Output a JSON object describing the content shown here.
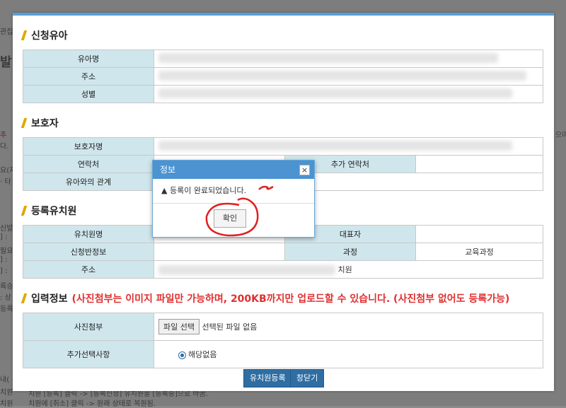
{
  "background_fragments": [
    "관집",
    "발",
    "추",
    "다.",
    "요(자",
    "· 타",
    "신발",
    "] :",
    "필요",
    "] :",
    "] :",
    "록승",
    ": 상",
    "등록",
    "내(",
    "치원",
    "치원",
    "으며"
  ],
  "background_footer": [
    "치원 [등록] 클릭 -> [등록신청] 유치원을 [등록중]으로 바꿈.",
    "치원에 [취소] 클릭 -> 원래 상태로 복원됨."
  ],
  "sections": {
    "child": "신청유아",
    "guardian": "보호자",
    "kinder": "등록유치원",
    "input": "입력정보",
    "input_note": "(사진첨부는 이미지 파일만 가능하며, 200KB까지만 업로드할 수 있습니다. (사진첨부 없어도 등록가능)"
  },
  "child_labels": [
    "유아명",
    "주소",
    "성별"
  ],
  "guardian_labels": {
    "name": "보호자명",
    "contact": "연락처",
    "extra_contact": "추가 연락처",
    "relation": "유아와의 관계"
  },
  "kinder_labels": {
    "name": "유치원명",
    "rep": "대표자",
    "class_info": "신청반정보",
    "course": "과정",
    "course_value": "교육과정",
    "address": "주소",
    "address_suffix": "치원"
  },
  "input_labels": {
    "photo": "사진첨부",
    "file_button": "파일 선택",
    "file_status": "선택된 파일 없음",
    "extra": "추가선택사항",
    "radio_label": "해당없음"
  },
  "buttons": {
    "register": "유치원등록",
    "close": "창닫기"
  },
  "dialog": {
    "title": "정보",
    "close": "×",
    "icon": "warning-icon",
    "message": "등록이 완료되었습니다.",
    "ok": "확인"
  },
  "colors": {
    "accent": "#4b93d1",
    "label_bg": "#cfe6ec",
    "note": "#e03030",
    "button": "#2f6ea3"
  }
}
